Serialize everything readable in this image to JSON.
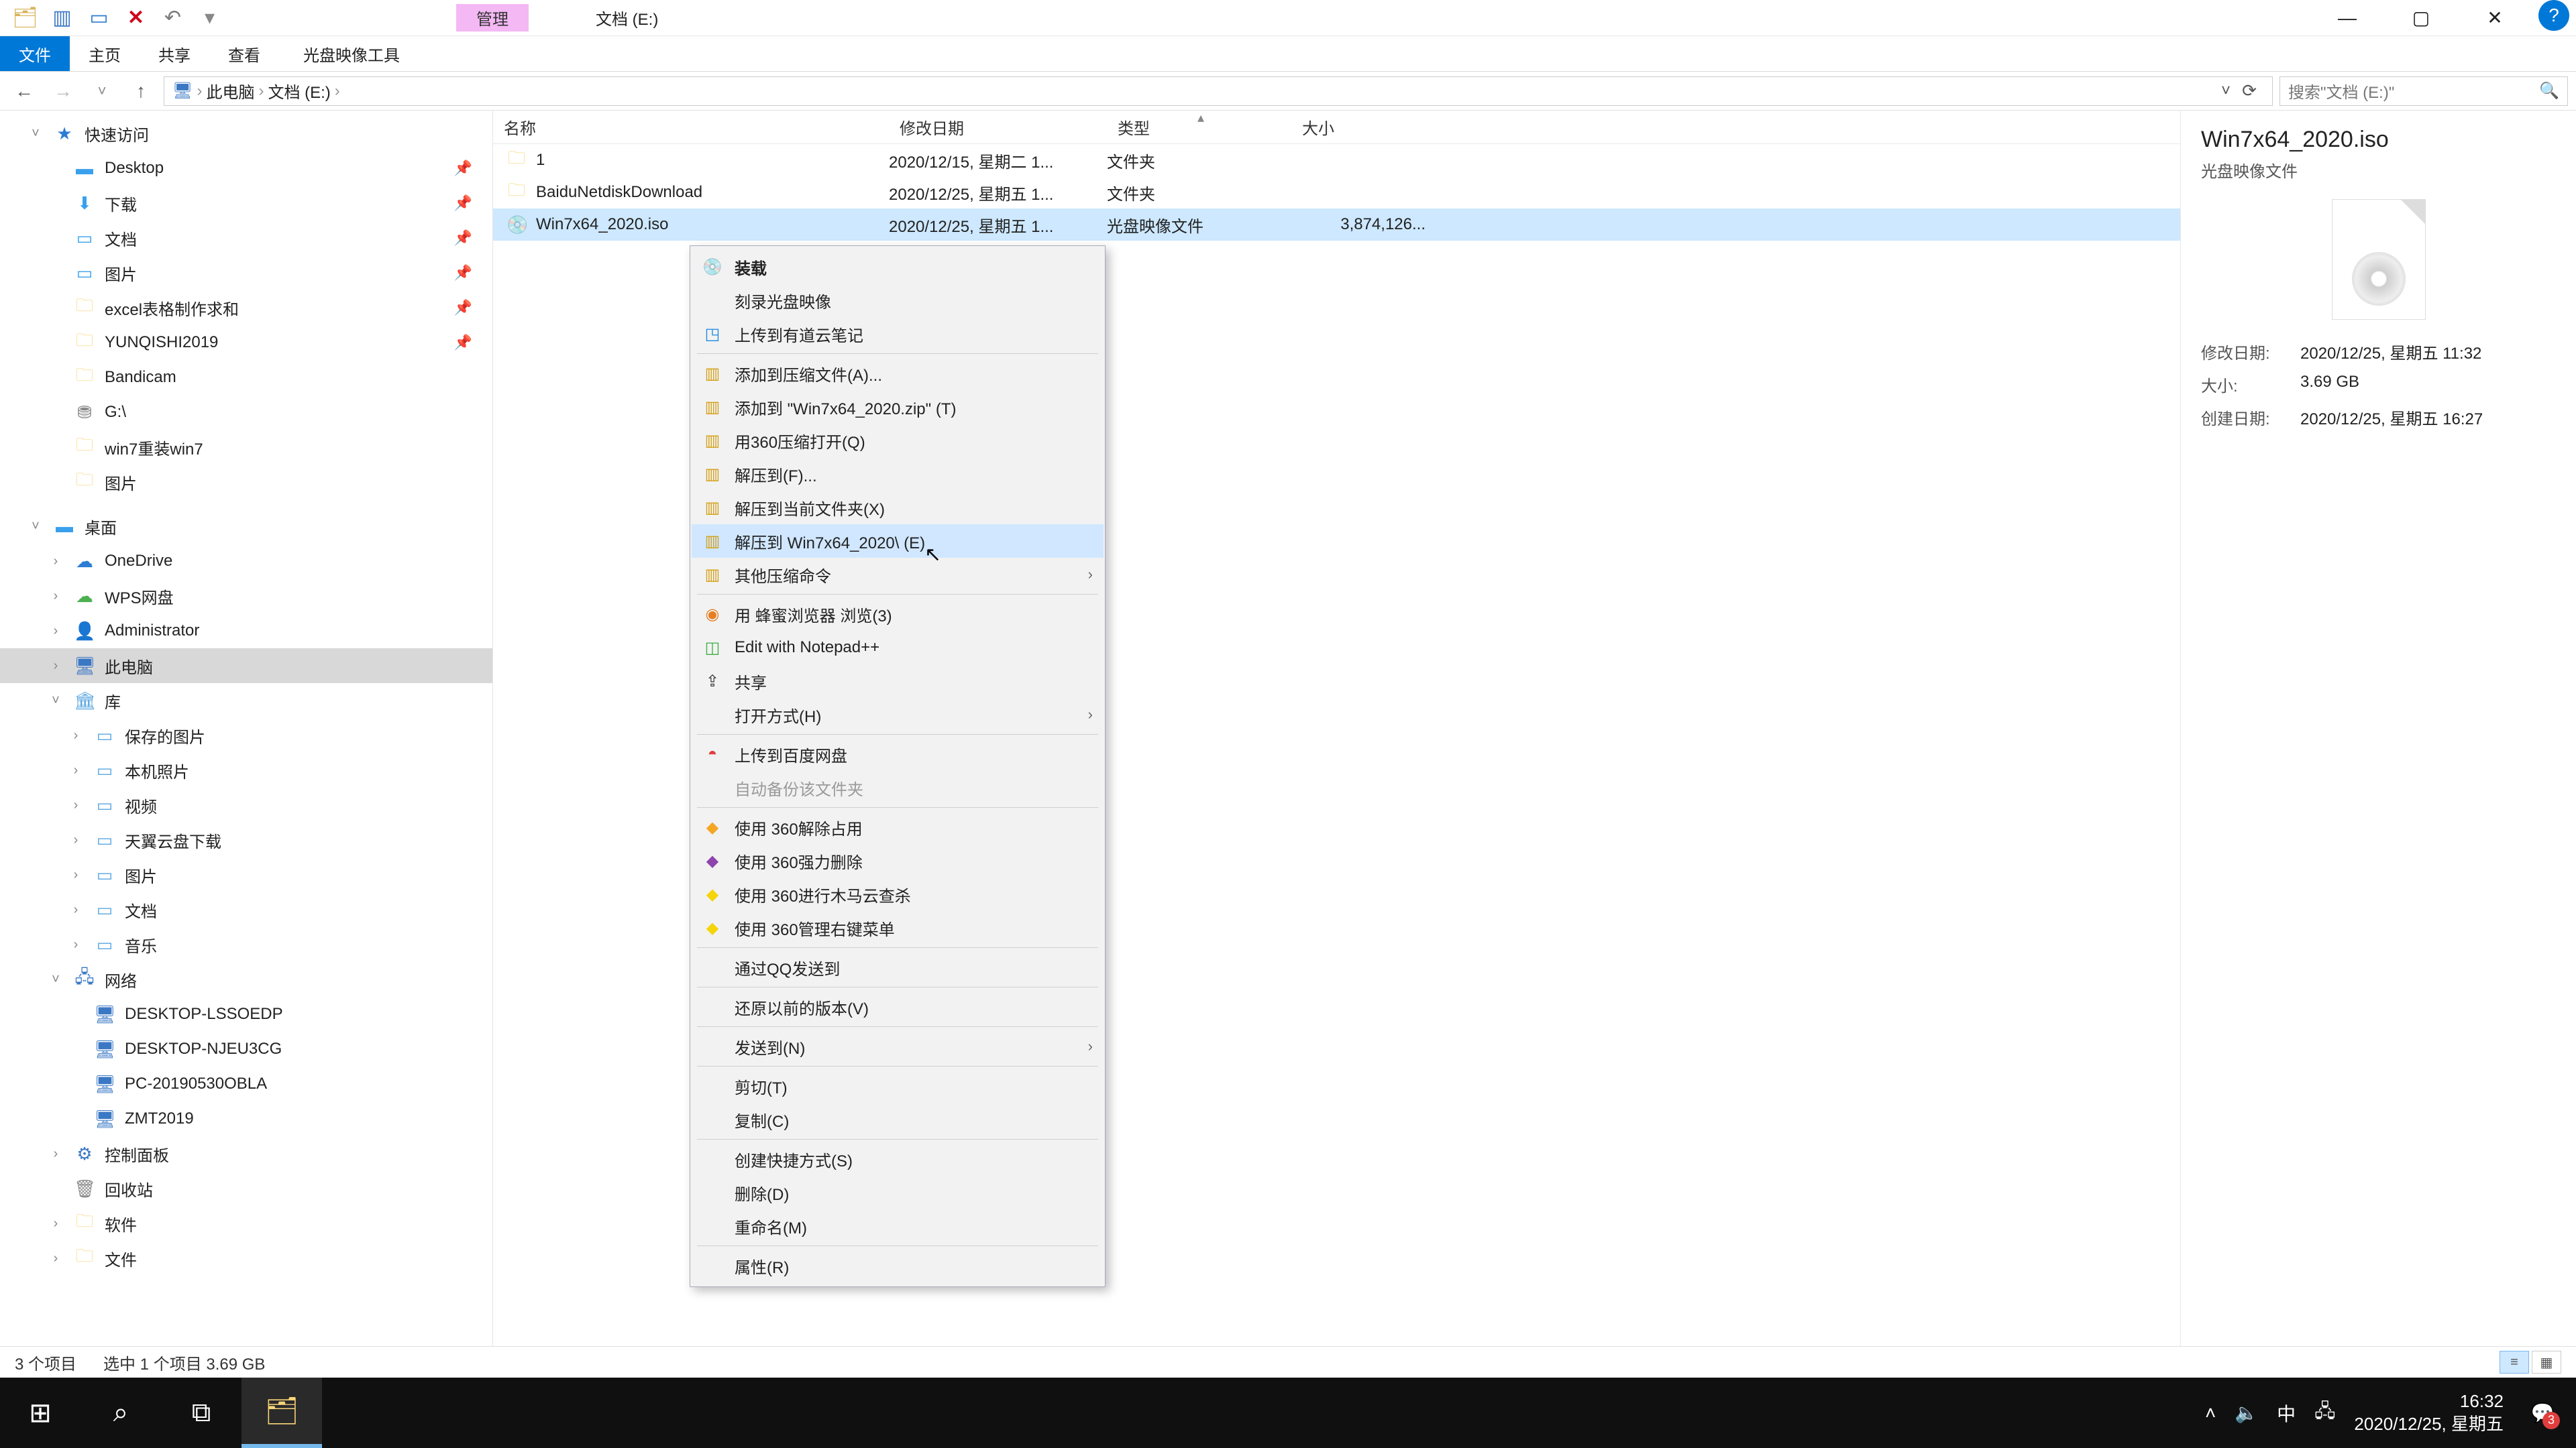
{
  "titlebar": {
    "context_tab": "管理",
    "title": "文档 (E:)"
  },
  "ribbon": {
    "file": "文件",
    "home": "主页",
    "share": "共享",
    "view": "查看",
    "tool": "光盘映像工具"
  },
  "addr": {
    "root": "此电脑",
    "folder": "文档 (E:)"
  },
  "search": {
    "placeholder": "搜索\"文档 (E:)\""
  },
  "tree": {
    "quick": "快速访问",
    "desktop": "Desktop",
    "downloads": "下载",
    "documents": "文档",
    "pictures": "图片",
    "excel": "excel表格制作求和",
    "yunqishi": "YUNQISHI2019",
    "bandicam": "Bandicam",
    "gdrive": "G:\\",
    "win7": "win7重装win7",
    "pics2": "图片",
    "desk_section": "桌面",
    "onedrive": "OneDrive",
    "wps": "WPS网盘",
    "admin": "Administrator",
    "thispc": "此电脑",
    "libraries": "库",
    "saved_pics": "保存的图片",
    "local_pics": "本机照片",
    "videos": "视频",
    "tianyi": "天翼云盘下载",
    "libpics": "图片",
    "libdocs": "文档",
    "libmusic": "音乐",
    "network": "网络",
    "pc1": "DESKTOP-LSSOEDP",
    "pc2": "DESKTOP-NJEU3CG",
    "pc3": "PC-20190530OBLA",
    "pc4": "ZMT2019",
    "ctrlpanel": "控制面板",
    "recycle": "回收站",
    "soft": "软件",
    "files": "文件"
  },
  "cols": {
    "name": "名称",
    "date": "修改日期",
    "type": "类型",
    "size": "大小"
  },
  "rows": [
    {
      "name": "1",
      "date": "2020/12/15, 星期二 1...",
      "type": "文件夹",
      "size": ""
    },
    {
      "name": "BaiduNetdiskDownload",
      "date": "2020/12/25, 星期五 1...",
      "type": "文件夹",
      "size": ""
    },
    {
      "name": "Win7x64_2020.iso",
      "date": "2020/12/25, 星期五 1...",
      "type": "光盘映像文件",
      "size": "3,874,126..."
    }
  ],
  "details": {
    "title": "Win7x64_2020.iso",
    "subtitle": "光盘映像文件",
    "mdate_label": "修改日期:",
    "mdate": "2020/12/25, 星期五 11:32",
    "size_label": "大小:",
    "size": "3.69 GB",
    "cdate_label": "创建日期:",
    "cdate": "2020/12/25, 星期五 16:27"
  },
  "ctx": {
    "mount": "装载",
    "burn": "刻录光盘映像",
    "youdao": "上传到有道云笔记",
    "add_archive": "添加到压缩文件(A)...",
    "add_zip": "添加到 \"Win7x64_2020.zip\" (T)",
    "open_360zip": "用360压缩打开(Q)",
    "extract_to": "解压到(F)...",
    "extract_here": "解压到当前文件夹(X)",
    "extract_named": "解压到 Win7x64_2020\\ (E)",
    "other_zip": "其他压缩命令",
    "bee_browser": "用 蜂蜜浏览器 浏览(3)",
    "notepadpp": "Edit with Notepad++",
    "share": "共享",
    "open_with": "打开方式(H)",
    "baidu": "上传到百度网盘",
    "auto_backup": "自动备份该文件夹",
    "unlock360": "使用 360解除占用",
    "force_del360": "使用 360强力删除",
    "trojan360": "使用 360进行木马云查杀",
    "manage360": "使用 360管理右键菜单",
    "qq_send": "通过QQ发送到",
    "restore": "还原以前的版本(V)",
    "send_to": "发送到(N)",
    "cut": "剪切(T)",
    "copy": "复制(C)",
    "shortcut": "创建快捷方式(S)",
    "delete": "删除(D)",
    "rename": "重命名(M)",
    "props": "属性(R)"
  },
  "status": {
    "count": "3 个项目",
    "selected": "选中 1 个项目  3.69 GB"
  },
  "taskbar": {
    "ime": "中",
    "time": "16:32",
    "date": "2020/12/25, 星期五",
    "badge": "3"
  }
}
